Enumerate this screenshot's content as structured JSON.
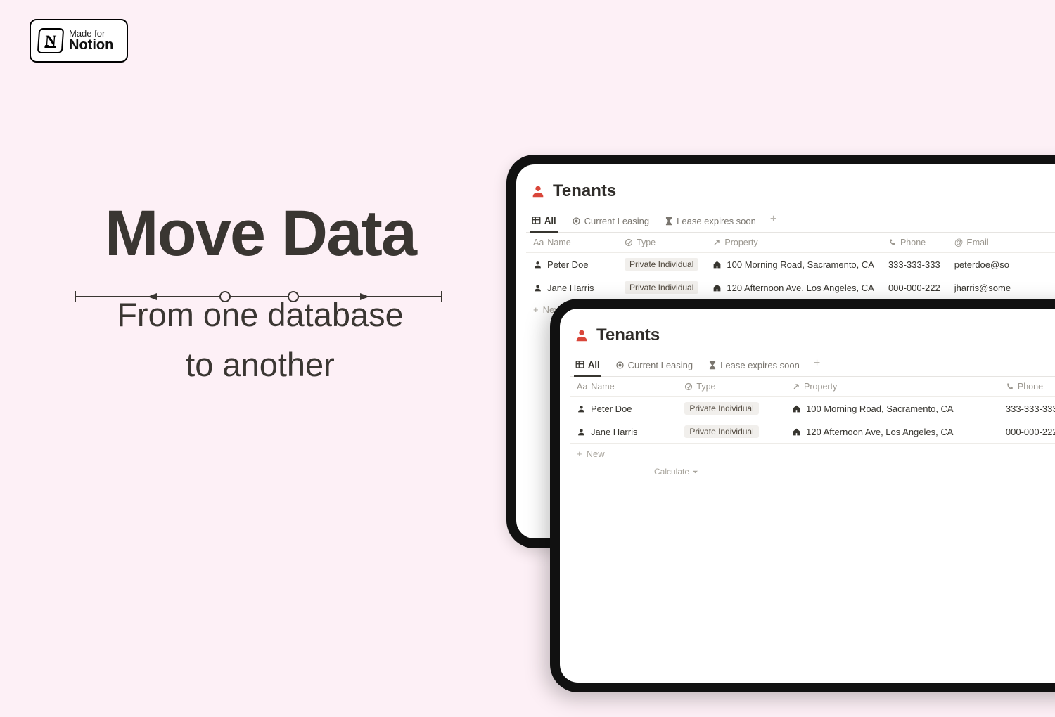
{
  "badge": {
    "top": "Made for",
    "brand": "Notion",
    "glyph": "N"
  },
  "headline": {
    "title": "Move Data",
    "subtitle_l1": "From one database",
    "subtitle_l2": "to another"
  },
  "db": {
    "title": "Tenants",
    "tabs": [
      {
        "label": "All",
        "icon": "table"
      },
      {
        "label": "Current Leasing",
        "icon": "target"
      },
      {
        "label": "Lease expires soon",
        "icon": "hourglass"
      }
    ],
    "columns": [
      {
        "label": "Name",
        "icon": "text"
      },
      {
        "label": "Type",
        "icon": "select"
      },
      {
        "label": "Property",
        "icon": "relation"
      },
      {
        "label": "Phone",
        "icon": "phone"
      },
      {
        "label": "Email",
        "icon": "email"
      }
    ],
    "rows": [
      {
        "name": "Peter Doe",
        "type": "Private Individual",
        "property": "100 Morning Road, Sacramento, CA",
        "phone": "333-333-333",
        "email": "peterdoe@so"
      },
      {
        "name": "Jane Harris",
        "type": "Private Individual",
        "property": "120 Afternoon Ave, Los Angeles, CA",
        "phone": "000-000-222",
        "email": "jharris@some"
      }
    ],
    "new_label": "New",
    "calculate_label": "Calculate"
  }
}
